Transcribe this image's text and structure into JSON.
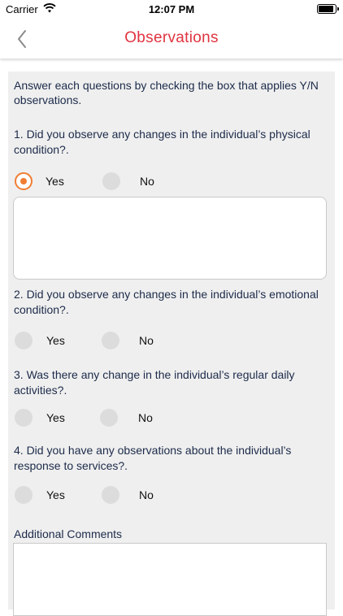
{
  "status_bar": {
    "carrier": "Carrier",
    "time": "12:07 PM"
  },
  "nav": {
    "title": "Observations",
    "back_icon": "chevron-left-icon"
  },
  "intro": "Answer each questions by checking the box that applies Y/N observations.",
  "questions": [
    {
      "text": "1. Did you observe any changes in the individual’s physical condition?.",
      "yes_label": "Yes",
      "no_label": "No",
      "selected": "Yes"
    },
    {
      "text": "2. Did you observe any changes in the individual’s emotional condition?.",
      "yes_label": "Yes",
      "no_label": "No",
      "selected": null
    },
    {
      "text": "3. Was there any change in the individual’s regular daily activities?.",
      "yes_label": "Yes",
      "no_label": "No",
      "selected": null
    },
    {
      "text": "4. Did you have any observations about the individual’s response to services?.",
      "yes_label": "Yes",
      "no_label": "No",
      "selected": null
    }
  ],
  "q1_details": {
    "value": ""
  },
  "additional_comments": {
    "label": "Additional Comments",
    "value": ""
  },
  "colors": {
    "accent": "#e03440",
    "radio_selected": "#f07d32",
    "panel": "#efefef"
  }
}
